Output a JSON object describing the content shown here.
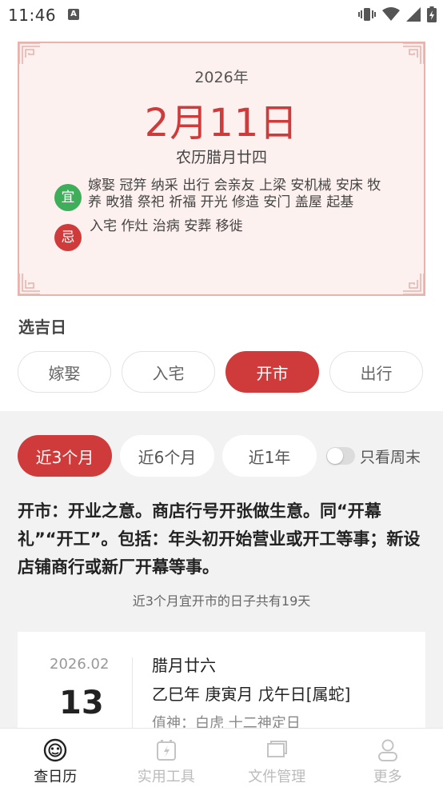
{
  "status_bar": {
    "time": "11:46",
    "notif": "A"
  },
  "calendar": {
    "year": "2026年",
    "date": "2月11日",
    "lunar": "农历腊月廿四",
    "yi_label": "宜",
    "yi_text": "嫁娶 冠笄 纳采 出行 会亲友 上梁 安机械 安床 牧养 畋猎 祭祀 祈福 开光 修造 安门 盖屋 起基",
    "ji_label": "忌",
    "ji_text": "入宅 作灶 治病 安葬 移徙"
  },
  "select_day": {
    "title": "选吉日",
    "categories": [
      "嫁娶",
      "入宅",
      "开市",
      "出行"
    ],
    "active_category": "开市"
  },
  "range": {
    "options": [
      "近3个月",
      "近6个月",
      "近1年"
    ],
    "active": "近3个月",
    "weekend_toggle_label": "只看周末",
    "weekend_only": false
  },
  "description": "开市：开业之意。商店行号开张做生意。同“开幕礼”“开工”。包括：年头初开始营业或开工等事；新设店铺商行或新厂开幕等事。",
  "count_line": "近3个月宜开市的日子共有19天",
  "day_item": {
    "year_month": "2026.02",
    "day": "13",
    "lunar": "腊月廿六",
    "ganzhi": "乙巳年 庚寅月 戊午日[属蛇]",
    "gods": "值神：白虎   十二神定日"
  },
  "nav": {
    "items": [
      "查日历",
      "实用工具",
      "文件管理",
      "更多"
    ],
    "active": "查日历"
  },
  "colors": {
    "accent": "#cf3b3b",
    "yi": "#3fae5a",
    "card_bg": "#fdf1ef",
    "card_border": "#e8b3ad"
  }
}
